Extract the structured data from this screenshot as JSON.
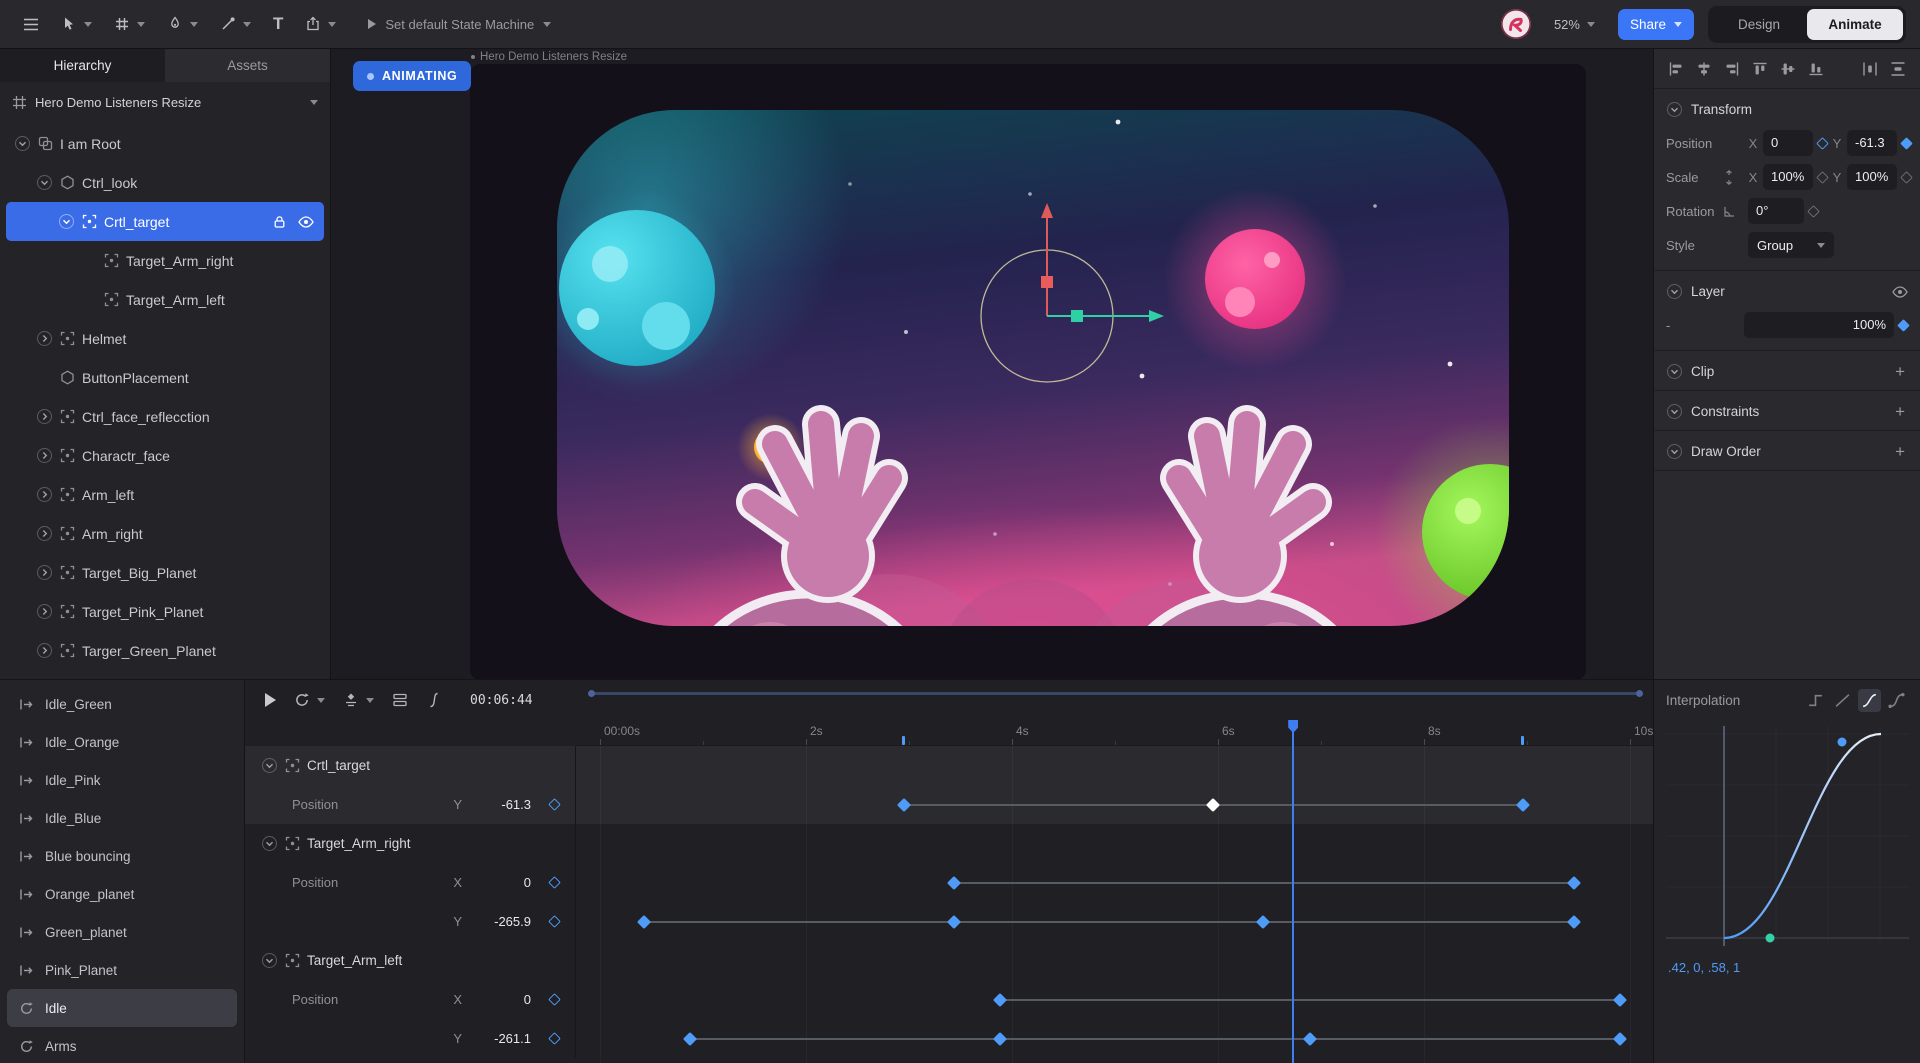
{
  "toolbar": {
    "state_machine_label": "Set default State Machine",
    "zoom_level": "52%",
    "share_label": "Share",
    "design_label": "Design",
    "animate_label": "Animate",
    "text_tool_glyph": "T"
  },
  "left_panel": {
    "tabs": [
      {
        "label": "Hierarchy",
        "active": true
      },
      {
        "label": "Assets",
        "active": false
      }
    ],
    "artboard_name": "Hero Demo Listeners Resize",
    "tree": [
      {
        "label": "I am Root",
        "depth": 1,
        "caret": "expanded",
        "icon": "root",
        "selected": false
      },
      {
        "label": "Ctrl_look",
        "depth": 2,
        "caret": "expanded",
        "icon": "hex",
        "selected": false
      },
      {
        "label": "Crtl_target",
        "depth": 3,
        "caret": "expanded",
        "icon": "target",
        "selected": true,
        "locked": true,
        "visible": true
      },
      {
        "label": "Target_Arm_right",
        "depth": 4,
        "caret": "none",
        "icon": "target",
        "selected": false
      },
      {
        "label": "Target_Arm_left",
        "depth": 4,
        "caret": "none",
        "icon": "target",
        "selected": false
      },
      {
        "label": "Helmet",
        "depth": 2,
        "caret": "collapsed",
        "icon": "target",
        "selected": false
      },
      {
        "label": "ButtonPlacement",
        "depth": 2,
        "caret": "none",
        "icon": "hex",
        "selected": false
      },
      {
        "label": "Ctrl_face_reflecction",
        "depth": 2,
        "caret": "collapsed",
        "icon": "target",
        "selected": false
      },
      {
        "label": "Charactr_face",
        "depth": 2,
        "caret": "collapsed",
        "icon": "target",
        "selected": false
      },
      {
        "label": "Arm_left",
        "depth": 2,
        "caret": "collapsed",
        "icon": "target",
        "selected": false
      },
      {
        "label": "Arm_right",
        "depth": 2,
        "caret": "collapsed",
        "icon": "target",
        "selected": false
      },
      {
        "label": "Target_Big_Planet",
        "depth": 2,
        "caret": "collapsed",
        "icon": "target",
        "selected": false
      },
      {
        "label": "Target_Pink_Planet",
        "depth": 2,
        "caret": "collapsed",
        "icon": "target",
        "selected": false
      },
      {
        "label": "Targer_Green_Planet",
        "depth": 2,
        "caret": "collapsed",
        "icon": "target",
        "selected": false
      }
    ]
  },
  "animations": [
    {
      "label": "Idle_Green",
      "mode": "oneshot",
      "selected": false
    },
    {
      "label": "Idle_Orange",
      "mode": "oneshot",
      "selected": false
    },
    {
      "label": "Idle_Pink",
      "mode": "oneshot",
      "selected": false
    },
    {
      "label": "Idle_Blue",
      "mode": "oneshot",
      "selected": false
    },
    {
      "label": "Blue bouncing",
      "mode": "oneshot",
      "selected": false
    },
    {
      "label": "Orange_planet",
      "mode": "oneshot",
      "selected": false
    },
    {
      "label": "Green_planet",
      "mode": "oneshot",
      "selected": false
    },
    {
      "label": "Pink_Planet",
      "mode": "oneshot",
      "selected": false
    },
    {
      "label": "Idle",
      "mode": "loop",
      "selected": true
    },
    {
      "label": "Arms",
      "mode": "loop",
      "selected": false
    }
  ],
  "canvas": {
    "animating_badge": "ANIMATING",
    "artboard_label": "Hero Demo Listeners Resize"
  },
  "properties": {
    "transform_title": "Transform",
    "position": {
      "label": "Position",
      "x_label": "X",
      "x": "0",
      "y_label": "Y",
      "y": "-61.3"
    },
    "scale": {
      "label": "Scale",
      "x_label": "X",
      "x": "100%",
      "y_label": "Y",
      "y": "100%"
    },
    "rotation": {
      "label": "Rotation",
      "value": "0°"
    },
    "style": {
      "label": "Style",
      "value": "Group"
    },
    "layer_title": "Layer",
    "layer_blend": "-",
    "layer_opacity": "100%",
    "clip_title": "Clip",
    "constraints_title": "Constraints",
    "draw_order_title": "Draw Order"
  },
  "timeline": {
    "time_display": "00:06:44",
    "playhead_time": 6.73,
    "ruler": [
      {
        "label": "00:00s",
        "t": 0
      },
      {
        "label": "2s",
        "t": 2
      },
      {
        "label": "4s",
        "t": 4
      },
      {
        "label": "6s",
        "t": 6
      },
      {
        "label": "8s",
        "t": 8
      },
      {
        "label": "10s",
        "t": 10
      }
    ],
    "ruler_markers": [
      2.95,
      8.96
    ],
    "tracks": [
      {
        "name": "Crtl_target",
        "selected": true,
        "rows": [
          {
            "prop": "Position",
            "axis": "Y",
            "value": "-61.3",
            "keys": [
              2.95,
              5.95,
              8.96
            ],
            "selected_key": 5.95
          }
        ]
      },
      {
        "name": "Target_Arm_right",
        "selected": false,
        "rows": [
          {
            "prop": "Position",
            "axis": "X",
            "value": "0",
            "keys": [
              3.44,
              9.46
            ]
          },
          {
            "prop": "",
            "axis": "Y",
            "value": "-265.9",
            "keys": [
              0.43,
              3.44,
              6.44,
              9.46
            ]
          }
        ]
      },
      {
        "name": "Target_Arm_left",
        "selected": false,
        "rows": [
          {
            "prop": "Position",
            "axis": "X",
            "value": "0",
            "keys": [
              3.88,
              9.9
            ]
          },
          {
            "prop": "",
            "axis": "Y",
            "value": "-261.1",
            "keys": [
              0.87,
              3.88,
              6.89,
              9.9
            ]
          }
        ]
      }
    ]
  },
  "interpolation": {
    "title": "Interpolation",
    "cubic_values": ".42, 0, .58, 1"
  },
  "colors": {
    "accent_blue": "#3f7ef0",
    "keyframe_blue": "#4f9cf8",
    "selection_blue": "#3b6ce8",
    "animating_badge_bg": "#2e68db"
  }
}
